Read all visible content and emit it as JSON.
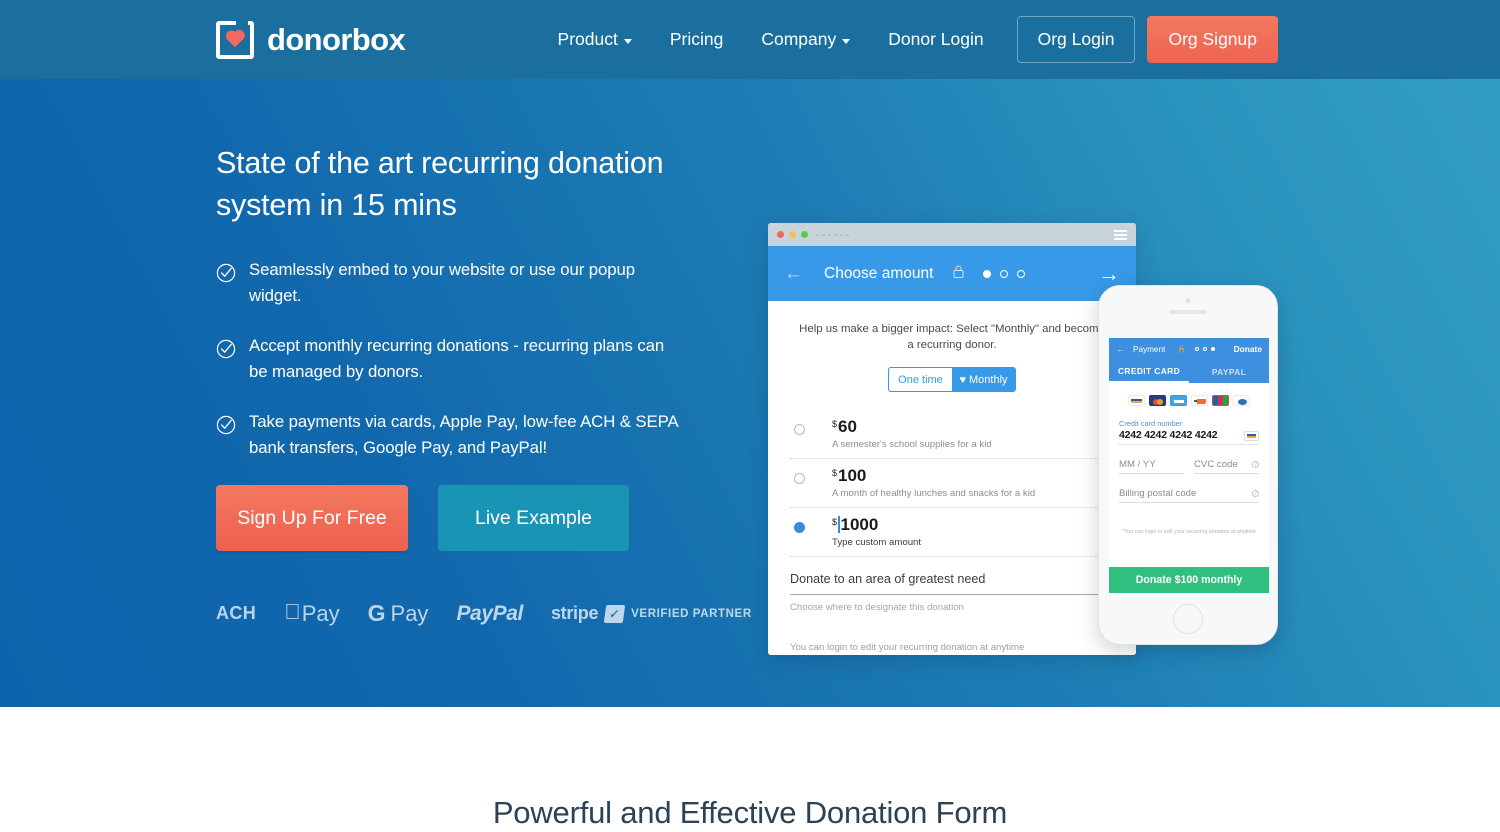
{
  "nav": {
    "logo_text": "donorbox",
    "logo_icon": "donorbox-heart-logo",
    "links": [
      {
        "label": "Product",
        "has_caret": true
      },
      {
        "label": "Pricing",
        "has_caret": false
      },
      {
        "label": "Company",
        "has_caret": true
      },
      {
        "label": "Donor Login",
        "has_caret": false
      }
    ],
    "org_login": "Org Login",
    "org_signup": "Org Signup"
  },
  "hero": {
    "title": "State of the art recurring donation system in 15 mins",
    "bullets": [
      "Seamlessly embed to your website or use our popup widget.",
      "Accept monthly recurring donations - recurring plans can be managed by donors.",
      "Take payments via cards, Apple Pay, low-fee ACH & SEPA bank transfers, Google Pay, and PayPal!"
    ],
    "cta_primary": "Sign Up For Free",
    "cta_secondary": "Live Example",
    "payment_logos": {
      "ach": "ACH",
      "apple_pay": "Pay",
      "gpay_g": "G",
      "gpay_pay": "Pay",
      "paypal": "PayPal",
      "stripe": "stripe",
      "stripe_verified": "VERIFIED PARTNER"
    }
  },
  "browser_mockup": {
    "form_title": "Choose amount",
    "impact_text": "Help us make a bigger impact: Select \"Monthly\" and become a recurring donor.",
    "freq_one_time": "One time",
    "freq_monthly": "Monthly",
    "currency": "$",
    "amounts": [
      {
        "value": "60",
        "desc": "A semester's school supplies for a kid",
        "selected": false
      },
      {
        "value": "100",
        "desc": "A month of healthy lunches and snacks for a kid",
        "selected": false
      },
      {
        "value": "1000",
        "desc": "Type custom amount",
        "selected": true
      }
    ],
    "designation": "Donate to an area of greatest need",
    "designation_help": "Choose where to designate this donation",
    "login_note": "You can login to edit  your recurring donation at anytime"
  },
  "phone_mockup": {
    "header_title": "Payment",
    "header_donate": "Donate",
    "tab_credit_card": "CREDIT CARD",
    "tab_paypal": "PAYPAL",
    "card_label": "Credit card number",
    "card_number": "4242 4242 4242 4242",
    "expiry_placeholder": "MM / YY",
    "cvc_placeholder": "CVC code",
    "postal_placeholder": "Billing postal code",
    "note": "*You can login to edit your recurring donation at anytime",
    "donate_button": "Donate $100 monthly"
  },
  "bottom_section": {
    "title": "Powerful and Effective Donation Form"
  },
  "colors": {
    "nav_bg": "#1a6f9e",
    "hero_gradient_start": "#0d63ab",
    "hero_gradient_end": "#339cc3",
    "accent_orange": "#ef6352",
    "accent_teal": "#1a94b5",
    "form_blue": "#3799e8",
    "donate_green": "#2fbf7e",
    "bottom_title": "#2b4257"
  }
}
